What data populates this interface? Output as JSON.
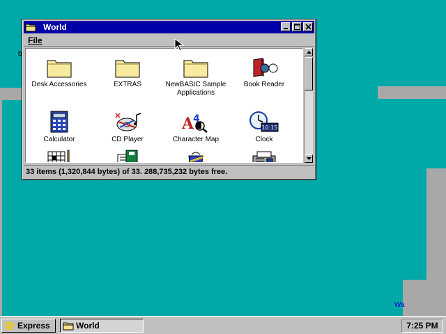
{
  "window": {
    "title": "World",
    "menu": [
      "File"
    ],
    "status": "33 items (1,320,844 bytes) of 33.  288,735,232 bytes free.",
    "icons": [
      {
        "label": "Desk Accessories",
        "icon": "folder-icon"
      },
      {
        "label": "EXTRAS",
        "icon": "folder-icon"
      },
      {
        "label": "NewBASIC Sample Applications",
        "icon": "folder-icon"
      },
      {
        "label": "Book Reader",
        "icon": "book-reader-icon"
      },
      {
        "label": "Calculator",
        "icon": "calculator-icon"
      },
      {
        "label": "CD Player",
        "icon": "cd-player-icon"
      },
      {
        "label": "Character Map",
        "icon": "character-map-icon"
      },
      {
        "label": "Clock",
        "icon": "clock-icon"
      },
      {
        "label": "",
        "icon": "crossword-icon"
      },
      {
        "label": "",
        "icon": "floppy-icon"
      },
      {
        "label": "",
        "icon": "paint-icon"
      },
      {
        "label": "",
        "icon": "fax-icon"
      }
    ],
    "clock_icon_time": "10:15"
  },
  "taskbar": {
    "start_label": "Express",
    "task_label": "World",
    "clock": "7:25 PM"
  },
  "colors": {
    "desktop": "#00A8A8",
    "titlebar": "#0000A8",
    "chrome": "#C0C0C0"
  }
}
